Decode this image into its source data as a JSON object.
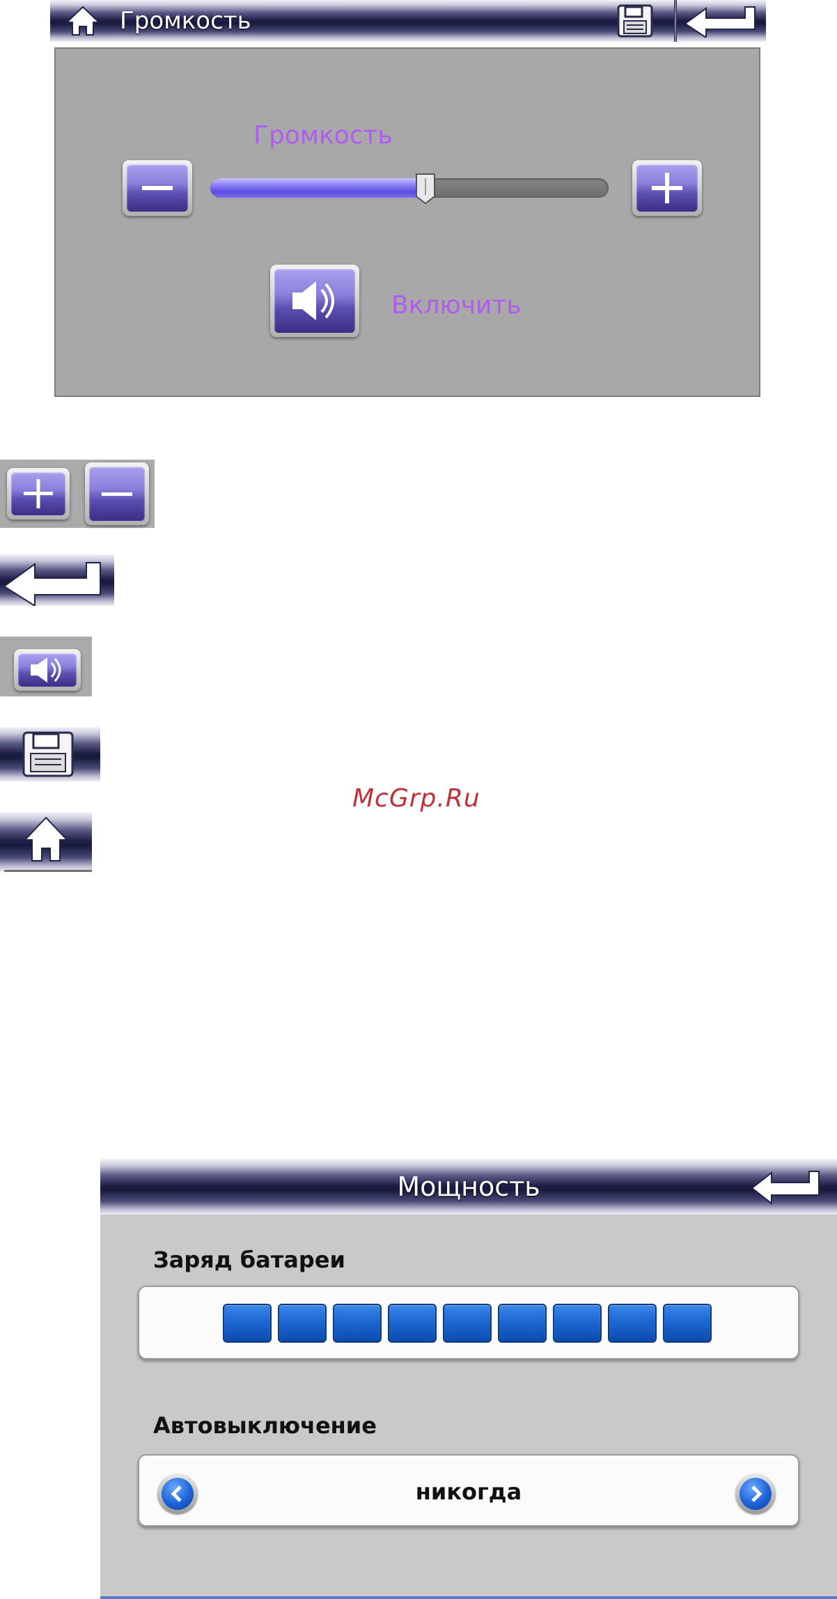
{
  "volume_screen": {
    "header_title": "Громкость",
    "volume_label": "Громкость",
    "volume_level_fraction": 0.54,
    "mute_toggle_label": "Включить",
    "icons": {
      "home": "home-icon",
      "save": "save-icon",
      "back": "back-arrow-icon",
      "minus": "minus-icon",
      "plus": "plus-icon",
      "speaker": "speaker-icon"
    },
    "label_color": "#b05cf0"
  },
  "icon_legend": {
    "items": [
      "plus-button",
      "minus-button",
      "back-button",
      "speaker-button",
      "save-button",
      "home-button"
    ]
  },
  "watermark": "McGrp.Ru",
  "power_screen": {
    "header_title": "Мощность",
    "battery_label": "Заряд батареи",
    "battery_cells_filled": 9,
    "battery_cells_total": 9,
    "auto_off_label": "Автовыключение",
    "auto_off_value": "никогда",
    "accent_color": "#1a64d0"
  }
}
